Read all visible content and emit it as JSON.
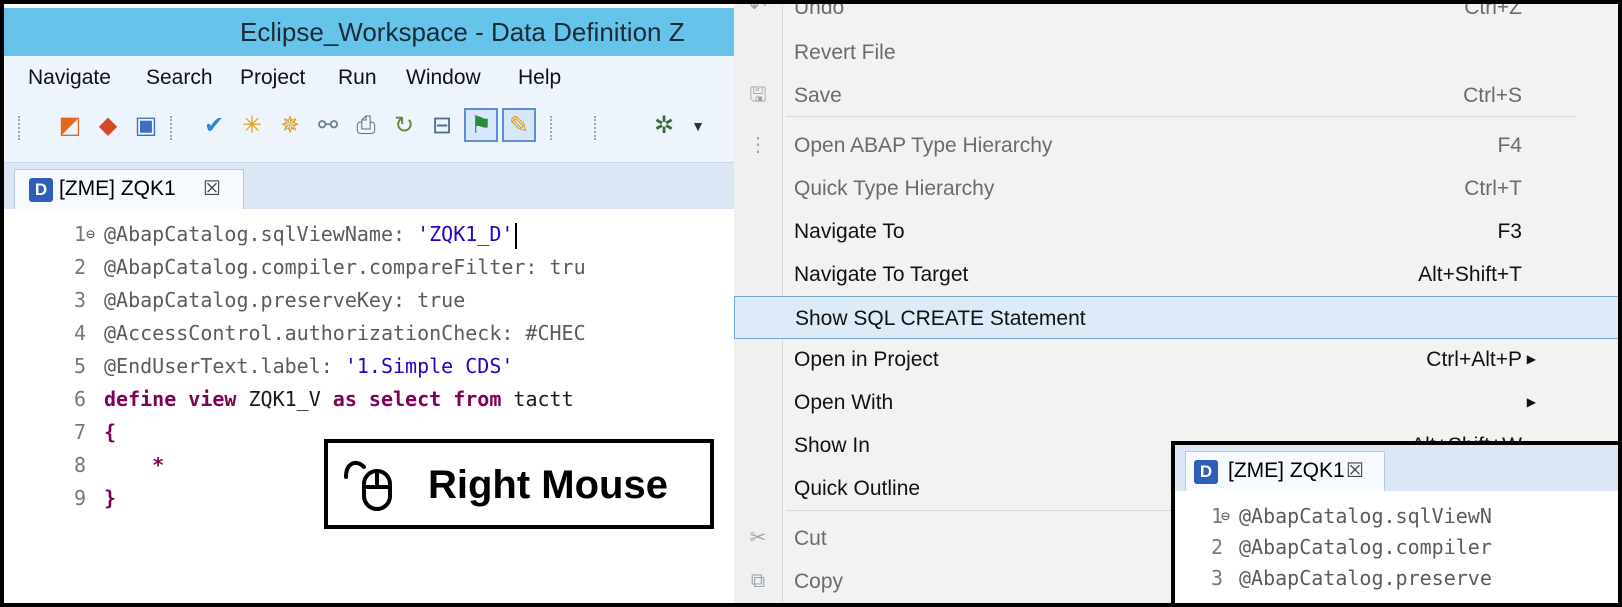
{
  "window": {
    "title": "Eclipse_Workspace - Data Definition Z"
  },
  "menu_bar": {
    "items": [
      "Navigate",
      "Search",
      "Project",
      "Run",
      "Window",
      "Help"
    ]
  },
  "editor": {
    "tab_label": "[ZME] ZQK1",
    "tab_close": "☒",
    "tab_icon_letter": "D",
    "lines": [
      {
        "num": "1",
        "fold": "⊖",
        "parts": [
          {
            "t": "@AbapCatalog.sqlViewName: ",
            "c": "anno"
          },
          {
            "t": "'ZQK1_D'",
            "c": "str"
          }
        ]
      },
      {
        "num": "2",
        "parts": [
          {
            "t": "@AbapCatalog.compiler.compareFilter: tru",
            "c": "anno"
          }
        ]
      },
      {
        "num": "3",
        "parts": [
          {
            "t": "@AbapCatalog.preserveKey: true",
            "c": "anno"
          }
        ]
      },
      {
        "num": "4",
        "parts": [
          {
            "t": "@AccessControl.authorizationCheck: #CHEC",
            "c": "anno"
          }
        ]
      },
      {
        "num": "5",
        "parts": [
          {
            "t": "@EndUserText.label: ",
            "c": "anno"
          },
          {
            "t": "'1.Simple CDS'",
            "c": "str"
          }
        ]
      },
      {
        "num": "6",
        "parts": [
          {
            "t": "define view ",
            "c": "kw"
          },
          {
            "t": "ZQK1_V ",
            "c": "plain"
          },
          {
            "t": "as select from ",
            "c": "kw"
          },
          {
            "t": "tactt",
            "c": "plain"
          }
        ]
      },
      {
        "num": "7",
        "parts": [
          {
            "t": "{",
            "c": "kw"
          }
        ]
      },
      {
        "num": "8",
        "parts": [
          {
            "t": "    *",
            "c": "kw"
          }
        ]
      },
      {
        "num": "9",
        "parts": [
          {
            "t": "}",
            "c": "kw"
          }
        ]
      }
    ]
  },
  "callout": {
    "label": "Right Mouse",
    "icon": "mouse-icon"
  },
  "context_menu": {
    "items": [
      {
        "label": "Undo",
        "shortcut": "Ctrl+Z",
        "enabled": false,
        "icon": "undo-icon"
      },
      {
        "label": "Revert File",
        "shortcut": "",
        "enabled": false
      },
      {
        "label": "Save",
        "shortcut": "Ctrl+S",
        "enabled": false,
        "icon": "save-icon"
      },
      {
        "label": "Open ABAP Type Hierarchy",
        "shortcut": "F4",
        "enabled": false,
        "icon": "hierarchy-icon"
      },
      {
        "label": "Quick Type Hierarchy",
        "shortcut": "Ctrl+T",
        "enabled": false
      },
      {
        "label": "Navigate To",
        "shortcut": "F3",
        "enabled": true
      },
      {
        "label": "Navigate To Target",
        "shortcut": "Alt+Shift+T",
        "enabled": true
      },
      {
        "label": "Show SQL CREATE Statement",
        "shortcut": "",
        "enabled": true,
        "highlighted": true
      },
      {
        "label": "Open in Project",
        "shortcut": "Ctrl+Alt+P",
        "enabled": true,
        "submenu": true
      },
      {
        "label": "Open With",
        "shortcut": "",
        "enabled": true,
        "submenu": true
      },
      {
        "label": "Show In",
        "shortcut": "Alt+Shift+W",
        "enabled": true,
        "submenu": true
      },
      {
        "label": "Quick Outline",
        "shortcut": "",
        "enabled": true
      },
      {
        "label": "Cut",
        "shortcut": "",
        "enabled": false,
        "icon": "cut-icon"
      },
      {
        "label": "Copy",
        "shortcut": "",
        "enabled": false,
        "icon": "copy-icon"
      }
    ]
  },
  "overlay_editor": {
    "tab_label": "[ZME] ZQK1",
    "tab_close": "☒",
    "tab_icon_letter": "D",
    "lines": [
      {
        "num": "1",
        "fold": "⊖",
        "text": "@AbapCatalog.sqlViewN"
      },
      {
        "num": "2",
        "text": "@AbapCatalog.compiler"
      },
      {
        "num": "3",
        "text": "@AbapCatalog.preserve"
      }
    ]
  }
}
